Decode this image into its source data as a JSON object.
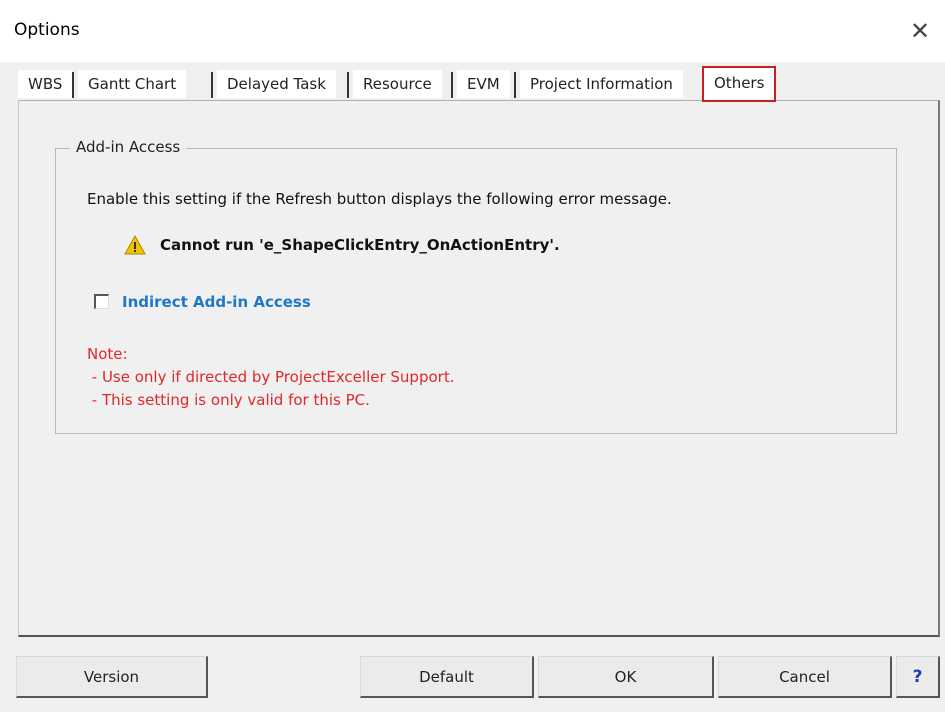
{
  "window": {
    "title": "Options",
    "close_glyph": "✕"
  },
  "tabs": [
    {
      "label": "WBS"
    },
    {
      "label": "Gantt Chart"
    },
    {
      "label": "Delayed Task"
    },
    {
      "label": "Resource"
    },
    {
      "label": "EVM"
    },
    {
      "label": "Project Information"
    },
    {
      "label": "Others",
      "active": true
    }
  ],
  "addin_access": {
    "legend": "Add-in Access",
    "description": "Enable this setting if the Refresh button displays the following error message.",
    "warning_icon": "warning-triangle-icon",
    "warning_text": "Cannot run 'e_ShapeClickEntry_OnActionEntry'.",
    "checkbox_label": "Indirect Add-in Access",
    "checkbox_checked": false,
    "note_title": "Note:",
    "note_lines": [
      " - Use only if directed by ProjectExceller Support.",
      " - This setting is only valid for this PC."
    ]
  },
  "buttons": {
    "version": "Version",
    "default": "Default",
    "ok": "OK",
    "cancel": "Cancel",
    "help": "?"
  },
  "colors": {
    "note_red": "#e0282a",
    "link_blue": "#1e78c8",
    "active_tab_border": "#cc2020",
    "warning_yellow": "#f2c200"
  }
}
